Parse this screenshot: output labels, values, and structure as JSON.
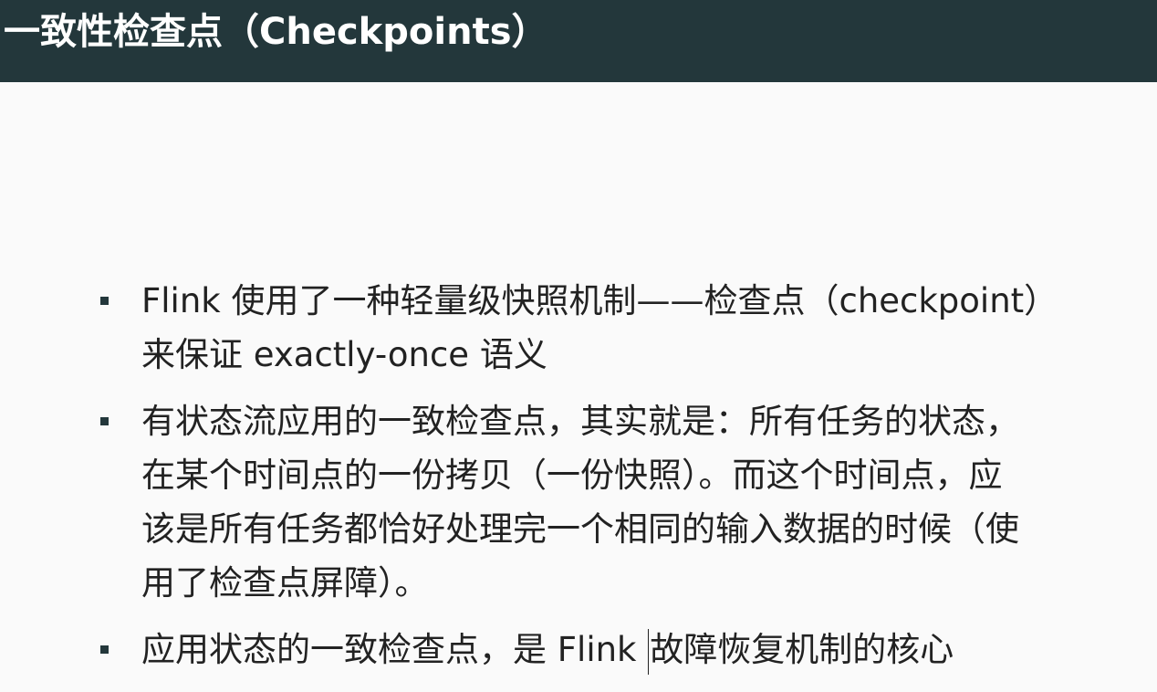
{
  "slide": {
    "title": "一致性检查点（Checkpoints）",
    "bullets": [
      {
        "lines": [
          "Flink 使用了一种轻量级快照机制——检查点（checkpoint）",
          "来保证 exactly-once 语义"
        ]
      },
      {
        "lines": [
          "有状态流应用的一致检查点，其实就是：所有任务的状态，",
          "在某个时间点的一份拷贝（一份快照）。而这个时间点，应",
          "该是所有任务都恰好处理完一个相同的输入数据的时候（使",
          "用了检查点屏障）。"
        ]
      },
      {
        "lines": [
          "应用状态的一致检查点，是 Flink ",
          "故障恢复机制的核心"
        ]
      }
    ]
  },
  "colors": {
    "title_bar": "#23373b",
    "title_text": "#ffffff",
    "background": "#fafafa",
    "body_text": "#222222"
  }
}
